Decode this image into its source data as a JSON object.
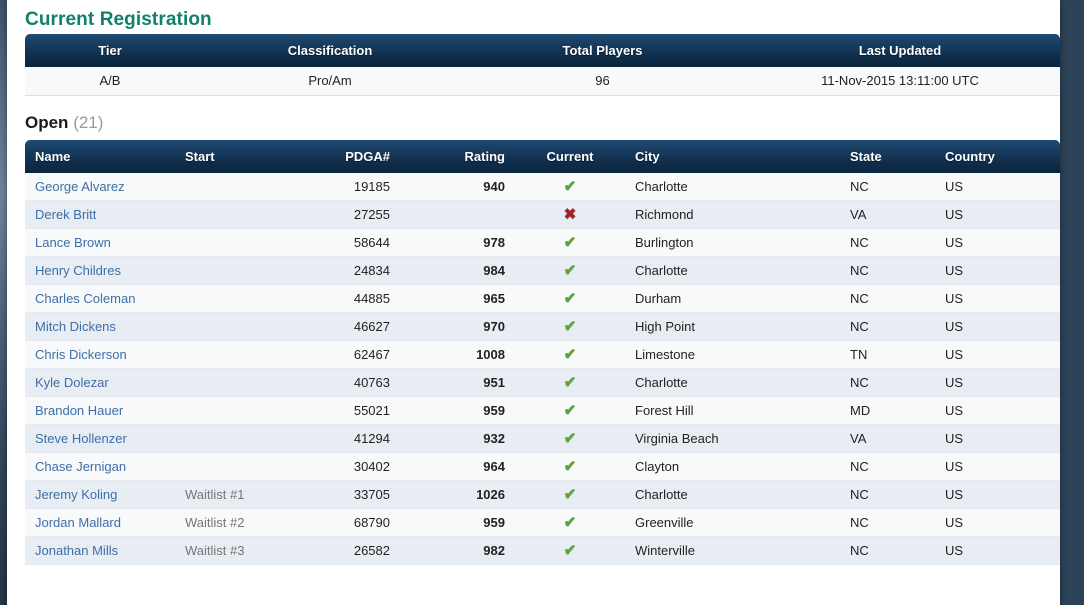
{
  "page": {
    "title": "Current Registration",
    "title_color": "#12806b"
  },
  "summary": {
    "columns": [
      "Tier",
      "Classification",
      "Total Players",
      "Last Updated"
    ],
    "row": {
      "tier": "A/B",
      "classification": "Pro/Am",
      "total_players": "96",
      "last_updated": "11-Nov-2015 13:11:00 UTC"
    }
  },
  "division": {
    "name": "Open",
    "count": "(21)"
  },
  "players_table": {
    "columns": [
      "Name",
      "Start",
      "PDGA#",
      "Rating",
      "Current",
      "City",
      "State",
      "Country"
    ],
    "icons": {
      "current_yes": "check-icon",
      "current_no": "cross-icon",
      "yes_glyph": "✔",
      "no_glyph": "✖",
      "yes_color": "#5aa32c",
      "no_color": "#a02222"
    },
    "rows": [
      {
        "name": "George Alvarez",
        "start": "",
        "pdga": "19185",
        "rating": "940",
        "current": "yes",
        "city": "Charlotte",
        "state": "NC",
        "country": "US"
      },
      {
        "name": "Derek Britt",
        "start": "",
        "pdga": "27255",
        "rating": "",
        "current": "no",
        "city": "Richmond",
        "state": "VA",
        "country": "US"
      },
      {
        "name": "Lance Brown",
        "start": "",
        "pdga": "58644",
        "rating": "978",
        "current": "yes",
        "city": "Burlington",
        "state": "NC",
        "country": "US"
      },
      {
        "name": "Henry Childres",
        "start": "",
        "pdga": "24834",
        "rating": "984",
        "current": "yes",
        "city": "Charlotte",
        "state": "NC",
        "country": "US"
      },
      {
        "name": "Charles Coleman",
        "start": "",
        "pdga": "44885",
        "rating": "965",
        "current": "yes",
        "city": "Durham",
        "state": "NC",
        "country": "US"
      },
      {
        "name": "Mitch Dickens",
        "start": "",
        "pdga": "46627",
        "rating": "970",
        "current": "yes",
        "city": "High Point",
        "state": "NC",
        "country": "US"
      },
      {
        "name": "Chris Dickerson",
        "start": "",
        "pdga": "62467",
        "rating": "1008",
        "current": "yes",
        "city": "Limestone",
        "state": "TN",
        "country": "US"
      },
      {
        "name": "Kyle Dolezar",
        "start": "",
        "pdga": "40763",
        "rating": "951",
        "current": "yes",
        "city": "Charlotte",
        "state": "NC",
        "country": "US"
      },
      {
        "name": "Brandon Hauer",
        "start": "",
        "pdga": "55021",
        "rating": "959",
        "current": "yes",
        "city": "Forest Hill",
        "state": "MD",
        "country": "US"
      },
      {
        "name": "Steve Hollenzer",
        "start": "",
        "pdga": "41294",
        "rating": "932",
        "current": "yes",
        "city": "Virginia Beach",
        "state": "VA",
        "country": "US"
      },
      {
        "name": "Chase Jernigan",
        "start": "",
        "pdga": "30402",
        "rating": "964",
        "current": "yes",
        "city": "Clayton",
        "state": "NC",
        "country": "US"
      },
      {
        "name": "Jeremy Koling",
        "start": "Waitlist #1",
        "pdga": "33705",
        "rating": "1026",
        "current": "yes",
        "city": "Charlotte",
        "state": "NC",
        "country": "US"
      },
      {
        "name": "Jordan Mallard",
        "start": "Waitlist #2",
        "pdga": "68790",
        "rating": "959",
        "current": "yes",
        "city": "Greenville",
        "state": "NC",
        "country": "US"
      },
      {
        "name": "Jonathan Mills",
        "start": "Waitlist #3",
        "pdga": "26582",
        "rating": "982",
        "current": "yes",
        "city": "Winterville",
        "state": "NC",
        "country": "US"
      }
    ]
  }
}
